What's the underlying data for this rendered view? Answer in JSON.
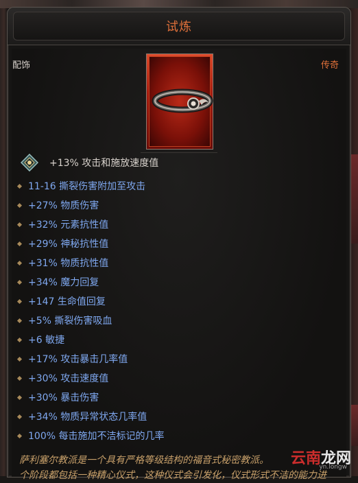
{
  "panel": {
    "title": "试炼",
    "item_type": "配饰",
    "rarity": "传奇"
  },
  "core_stat": {
    "icon": "skill-gem-icon",
    "text": "+13% 攻击和施放速度值"
  },
  "affixes": [
    "11-16 撕裂伤害附加至攻击",
    "+27% 物质伤害",
    "+32% 元素抗性值",
    "+29% 神秘抗性值",
    "+31% 物质抗性值",
    "+34% 魔力回复",
    "+147 生命值回复",
    "+5% 撕裂伤害吸血",
    "+6 敏捷",
    "+17% 攻击暴击几率值",
    "+30% 攻击速度值",
    "+30% 暴击伤害",
    "+34% 物质异常状态几率值",
    "100% 每击施加不洁标记的几率"
  ],
  "lore": {
    "line1": "萨利塞尔教派是一个具有严格等级结构的福音式秘密教派。",
    "line2": "个阶段都包括一种精心仪式，这种仪式会引发化，仪式形式不洁的能力进"
  },
  "watermark": {
    "text_red": "云南",
    "text_white": "龙网",
    "sub": "yn.longw"
  },
  "colors": {
    "title": "#e0703a",
    "rarity": "#e0703a",
    "affix": "#7fa8f0",
    "lore": "#c8a06a"
  }
}
